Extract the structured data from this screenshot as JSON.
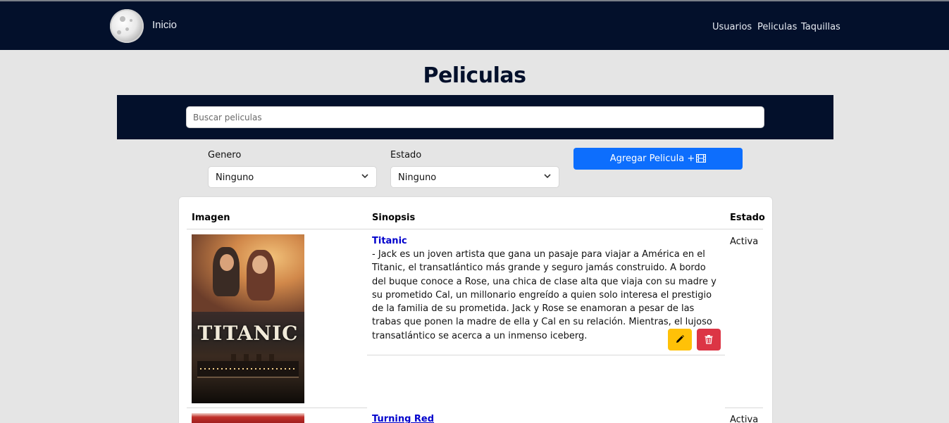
{
  "navbar": {
    "brand": "Inicio",
    "links": [
      "Usuarios",
      "Peliculas",
      "Taquillas"
    ]
  },
  "page": {
    "title": "Peliculas"
  },
  "search": {
    "placeholder": "Buscar peliculas"
  },
  "filters": {
    "genero_label": "Genero",
    "genero_value": "Ninguno",
    "estado_label": "Estado",
    "estado_value": "Ninguno",
    "add_button": "Agregar Pelicula +"
  },
  "table": {
    "headers": [
      "Imagen",
      "Sinopsis",
      "Estado"
    ],
    "rows": [
      {
        "poster_title": "TITANIC",
        "title": "Titanic",
        "synopsis": "- Jack es un joven artista que gana un pasaje para viajar a América en el Titanic, el transatlántico más grande y seguro jamás construido. A bordo del buque conoce a Rose, una chica de clase alta que viaja con su madre y su prometido Cal, un millonario engreído a quien solo interesa el prestigio de la familia de su prometida. Jack y Rose se enamoran a pesar de las trabas que ponen la madre de ella y Cal en su relación. Mientras, el lujoso transatlántico se acerca a un inmenso iceberg.",
        "status": "Activa"
      },
      {
        "title": "Turning Red",
        "status": "Activa"
      }
    ]
  },
  "colors": {
    "navy": "#03102b",
    "primary": "#0d6efd",
    "warning": "#ffc107",
    "danger": "#dc3545",
    "link": "#0000cc"
  },
  "icons": {
    "edit": "pencil-icon",
    "delete": "trash-icon",
    "add": "film-icon",
    "select": "chevron-down-icon"
  }
}
